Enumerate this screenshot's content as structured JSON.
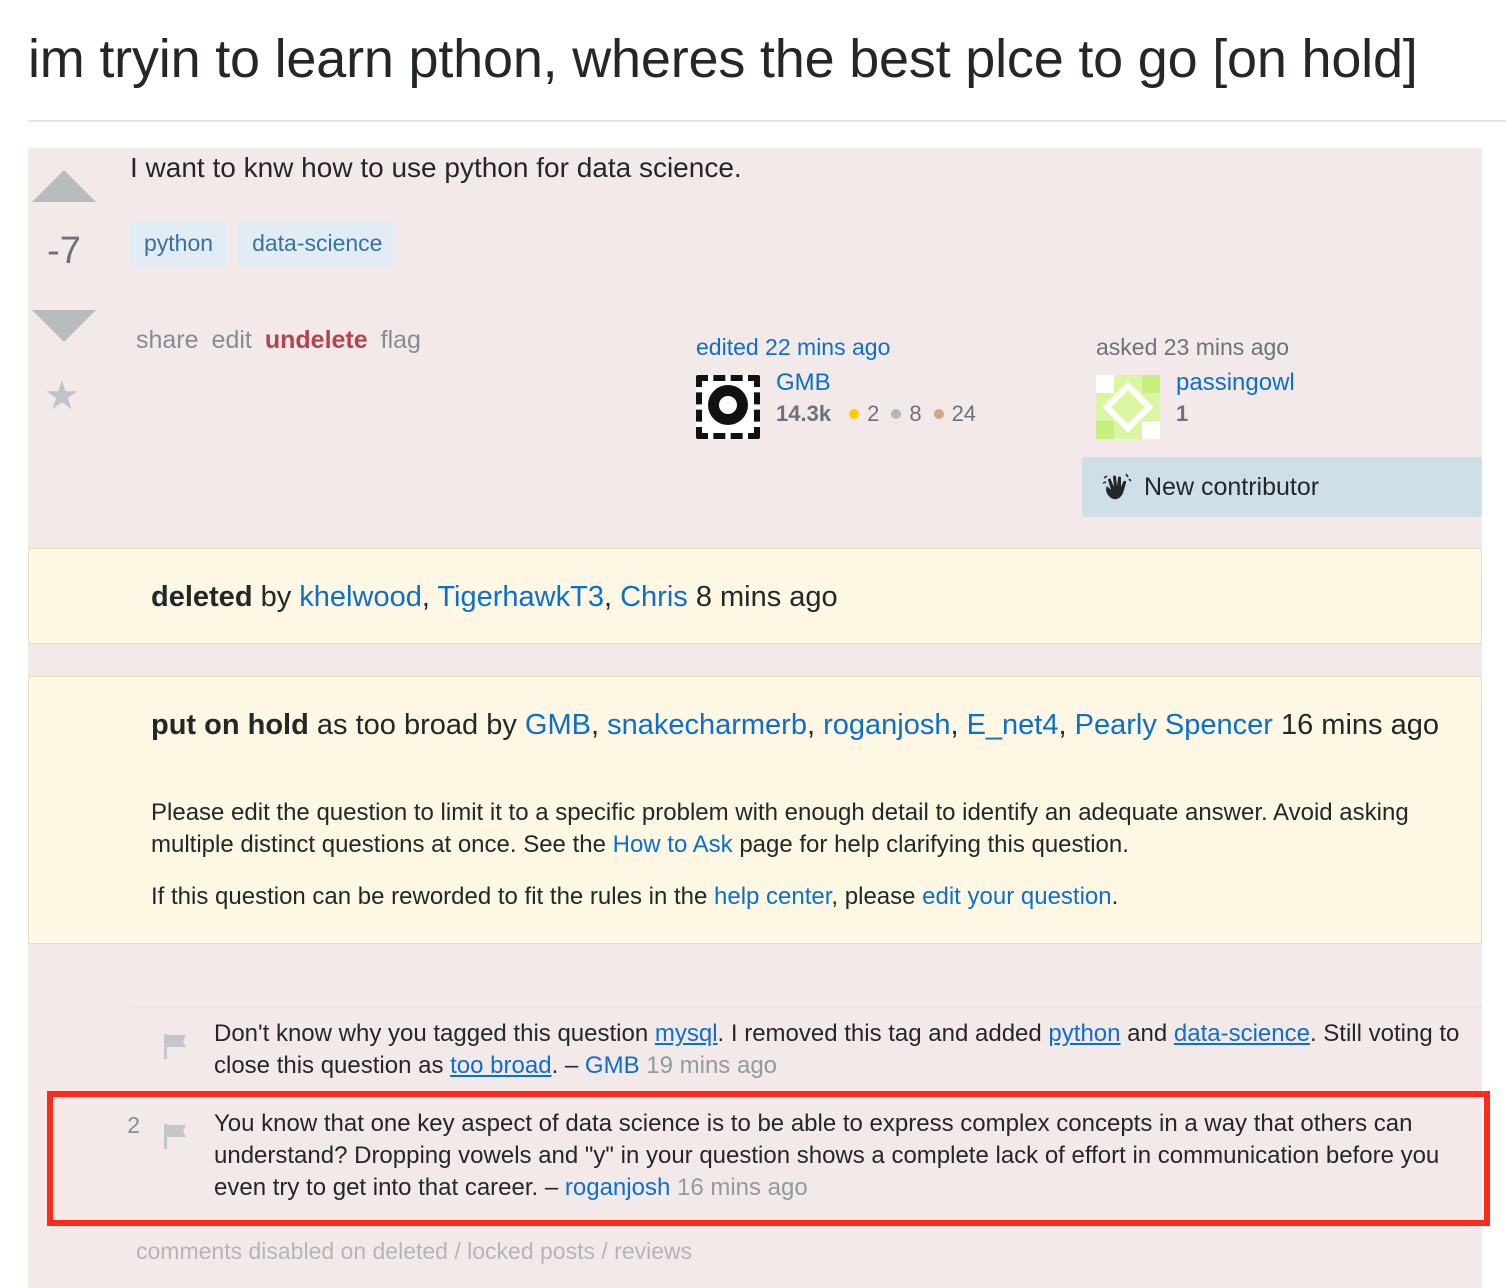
{
  "question": {
    "title": "im tryin to learn pthon, wheres the best plce to go [on hold]",
    "body": "I want to knw how to use python for data science.",
    "score": "-7",
    "tags": [
      "python",
      "data-science"
    ]
  },
  "post_menu": {
    "share": "share",
    "edit": "edit",
    "undelete": "undelete",
    "flag": "flag"
  },
  "editor": {
    "label": "edited 22 mins ago",
    "name": "GMB",
    "reputation": "14.3k",
    "gold": "2",
    "silver": "8",
    "bronze": "24"
  },
  "asker": {
    "label": "asked 23 mins ago",
    "name": "passingowl",
    "reputation": "1",
    "new_contributor": "New contributor"
  },
  "deleted_notice": {
    "bold": "deleted",
    "by": "by",
    "users": [
      "khelwood",
      "TigerhawkT3",
      "Chris"
    ],
    "time": "8 mins ago"
  },
  "hold_notice": {
    "bold": "put on hold",
    "reason": "as too broad by",
    "users": [
      "GMB",
      "snakecharmerb",
      "roganjosh",
      "E_net4",
      "Pearly Spencer"
    ],
    "time_a": "16 mins",
    "time_b": "ago",
    "para1_a": "Please edit the question to limit it to a specific problem with enough detail to identify an adequate answer. Avoid asking multiple distinct questions at once. See the",
    "para1_link": "How to Ask",
    "para1_b": "page for help clarifying this question.",
    "para2_a": "If this question can be reworded to fit the rules in the",
    "para2_link1": "help center",
    "para2_b": ", please",
    "para2_link2": "edit your question",
    "para2_c": "."
  },
  "comments": [
    {
      "score": "",
      "text_a": "Don't know why you tagged this question",
      "link_a": "mysql",
      "text_b": ". I removed this tag and added",
      "link_b": "python",
      "text_c": "and",
      "link_c": "data-science",
      "text_d": ". Still voting to close this question as",
      "link_d": "too broad",
      "text_e": ". –",
      "user": "GMB",
      "date": "19 mins ago"
    },
    {
      "score": "2",
      "text": "You know that one key aspect of data science is to be able to express complex concepts in a way that others can understand? Dropping vowels and \"y\" in your question shows a complete lack of effort in communication before you even try to get into that career. –",
      "user": "roganjosh",
      "date": "16 mins ago"
    }
  ],
  "comments_footer": "comments disabled on deleted / locked posts / reviews",
  "colors": {
    "post_bg": "#f4e9e9",
    "notice_bg": "#fdf7e3",
    "link": "#0c6fcc",
    "undelete": "#b5434f",
    "highlight": "#ff2a1a"
  }
}
